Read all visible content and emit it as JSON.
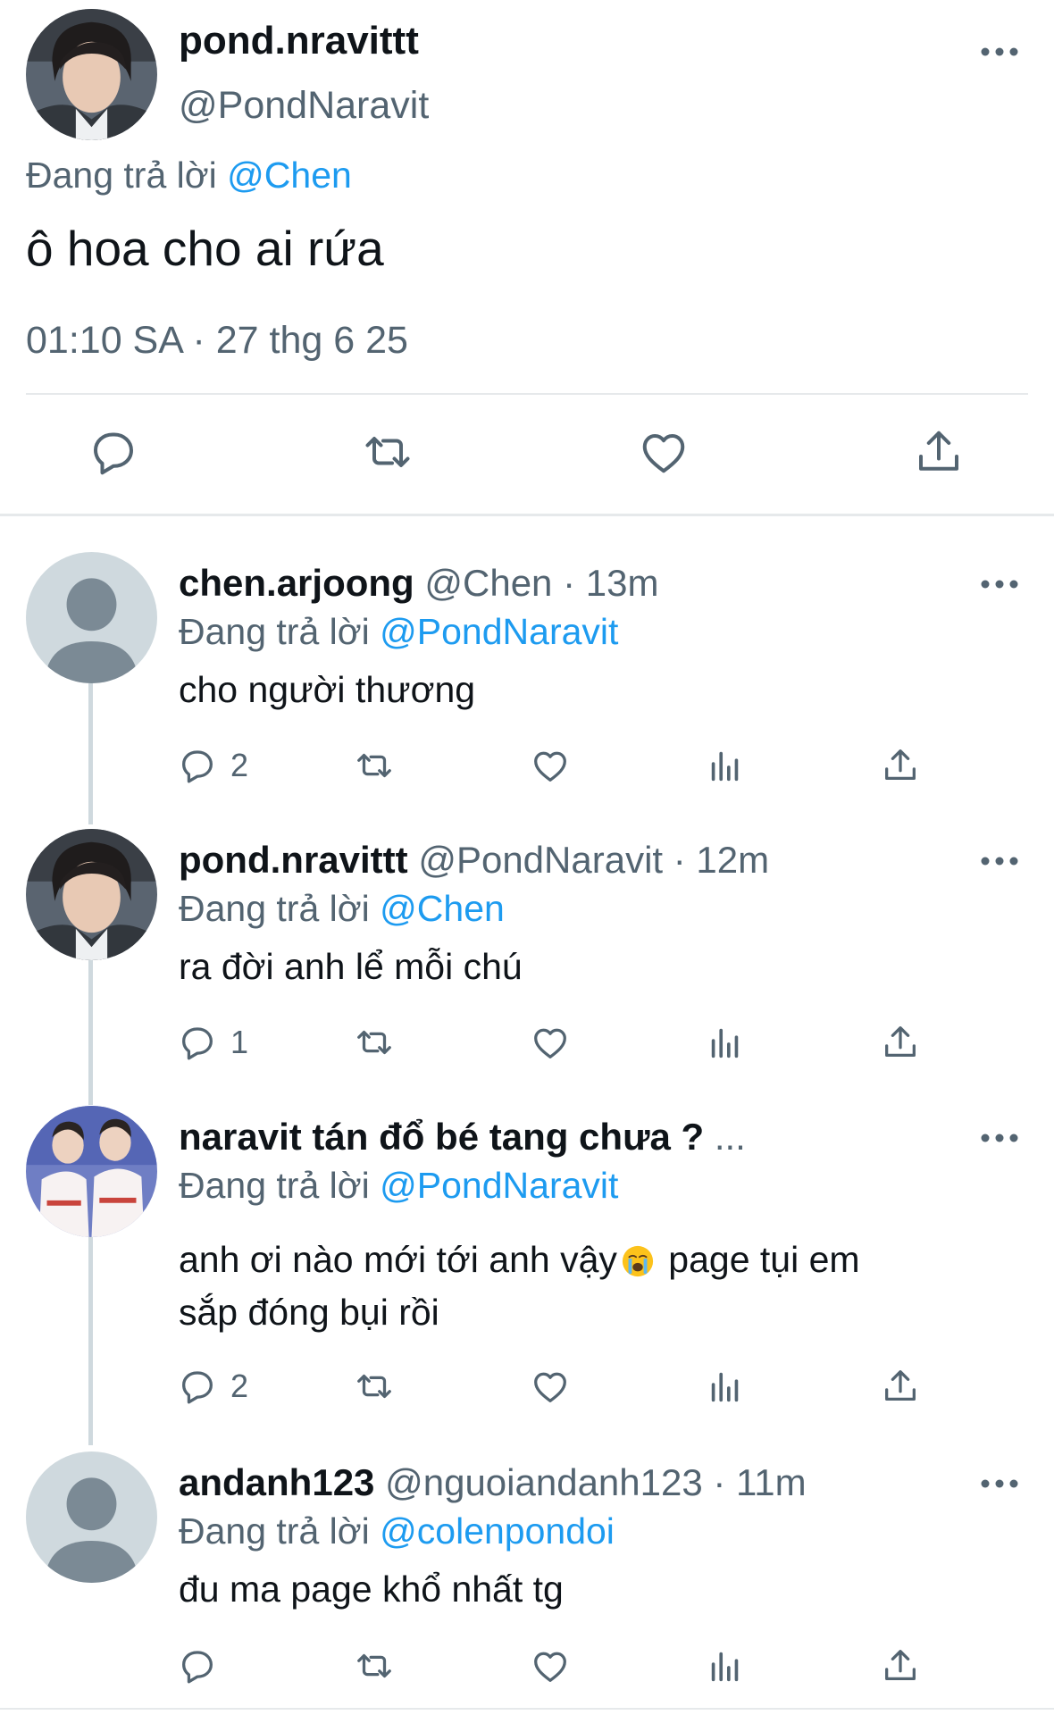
{
  "colors": {
    "accent": "#1d9bf0",
    "secondary_text": "#536471",
    "primary_text": "#0f1419",
    "divider": "#e6e9eb",
    "thread_line": "#cfd9de"
  },
  "main_tweet": {
    "display_name": "pond.nravittt",
    "handle": "@PondNaravit",
    "replying_prefix": "Đang trả lời",
    "replying_to": "@Chen",
    "text": "ô hoa cho ai rứa",
    "timestamp": "01:10 SA · 27 thg 6 25",
    "actions": [
      "reply-icon",
      "retweet-icon",
      "like-icon",
      "share-icon"
    ]
  },
  "replies": [
    {
      "display_name": "chen.arjoong",
      "handle_time": "@Chen · 13m",
      "replying_prefix": "Đang trả lời",
      "replying_to": "@PondNaravit",
      "text": "cho người thương",
      "reply_count": "2",
      "avatar": "default-avatar"
    },
    {
      "display_name": "pond.nravittt",
      "handle_time": "@PondNaravit · 12m",
      "replying_prefix": "Đang trả lời",
      "replying_to": "@Chen",
      "text": "ra đời anh lể mỗi chú",
      "reply_count": "1",
      "avatar": "profile-photo"
    },
    {
      "display_name": "naravit tán đổ bé tang chưa ?",
      "handle_time": "...",
      "replying_prefix": "Đang trả lời",
      "replying_to": "@PondNaravit",
      "text_line1_part1": "anh ơi nào mới tới anh vậy",
      "text_line1_part2": " page tụi em",
      "text_line2": "sắp đóng bụi rồi",
      "emoji": "loudly-crying-face-emoji",
      "reply_count": "2",
      "avatar": "group-photo"
    },
    {
      "display_name": "andanh123",
      "handle_time": "@nguoiandanh123 · 11m",
      "replying_prefix": "Đang trả lời",
      "replying_to": "@colenpondoi",
      "text": "đu ma page khổ nhất tg",
      "reply_count": "",
      "avatar": "default-avatar"
    }
  ],
  "reply_actions": [
    "reply-icon",
    "retweet-icon",
    "like-icon",
    "views-icon",
    "share-icon"
  ]
}
